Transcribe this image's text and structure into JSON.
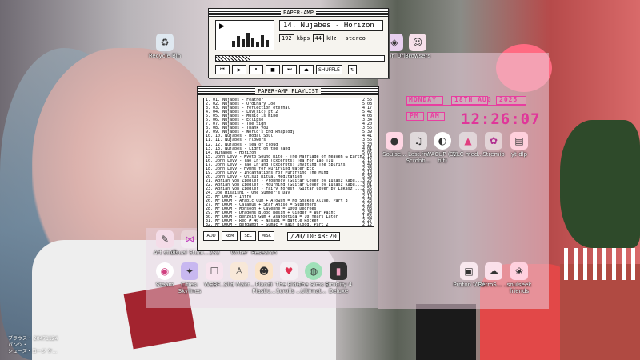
{
  "player": {
    "title": "PAPER-AMP",
    "track": "14. Nujabes - Horizon",
    "kbps_value": "192",
    "kbps_label": "kbps",
    "khz_value": "44",
    "khz_label": "kHz",
    "mode": "stereo",
    "shuffle": "SHUFFLE",
    "progress": 0.2
  },
  "playlist": {
    "title": "PAPER-AMP PLAYLIST",
    "time": "/20/10:48:20",
    "tracks": [
      {
        "t": "1. 01. Nujabes - Feather",
        "d": "2:55"
      },
      {
        "t": "2. 02. Nujabes - Ordinary Joe",
        "d": "5:08"
      },
      {
        "t": "3. 03. Nujabes - reflection eternal",
        "d": "4:17"
      },
      {
        "t": "4. 04. Nujabes - Luv(sic) pt.2",
        "d": "5:42"
      },
      {
        "t": "5. 05. Nujabes - Music is mine",
        "d": "4:08"
      },
      {
        "t": "6. 06. Nujabes - Eclipse",
        "d": "3:34"
      },
      {
        "t": "7. 07. Nujabes - The Sign",
        "d": "4:20"
      },
      {
        "t": "8. 08. Nujabes - Thank you",
        "d": "3:56"
      },
      {
        "t": "9. 09. Nujabes - World's End Rhapsody",
        "d": "5:39"
      },
      {
        "t": "10. 10. Nujabes - Modal Soul",
        "d": "4:41"
      },
      {
        "t": "11. 11. Nujabes - Flowers",
        "d": "3:55"
      },
      {
        "t": "12. 12. Nujabes - sea of cloud",
        "d": "3:20"
      },
      {
        "t": "13. 13. Nujabes - Light on the land",
        "d": "4:01"
      },
      {
        "t": "14. Nujabes - Horizon",
        "d": "5:05"
      },
      {
        "t": "15. John Levy - Kyoto Sound Rite - The Marriage of Heaven & Earth",
        "d": "2:14"
      },
      {
        "t": "16. John Levy - Tao Ch'ang (Excerpts) Tea For Lao Tzu",
        "d": "2:16"
      },
      {
        "t": "17. John Levy - Tao Ch'ang (Excerpts) Inviting The Spirits",
        "d": "3:49"
      },
      {
        "t": "18. John Levy - Hymns for Purifying Water Etc",
        "d": "2:33"
      },
      {
        "t": "19. John Levy - Incantations For Purifying The Mind",
        "d": "2:18"
      },
      {
        "t": "20. John Levy - Chisui Ritual Meditation",
        "d": "5:39"
      },
      {
        "t": "21. Adrian von Ziegler - Prophecy (Guitar Cover by Lukasz Kapu...",
        "d": "3:25"
      },
      {
        "t": "22. Adrian von Ziegler - Mourning (Guitar Cover by Lukasz Kapu...",
        "d": "3:01"
      },
      {
        "t": "23. Adrian von Ziegler - Fairy Forest (Guitar Cover by Lukasz ...",
        "d": "2:55"
      },
      {
        "t": "24. Joe Hisaishi - One Summer's Day",
        "d": "3:09"
      },
      {
        "t": "25. MF DOOM - Intro",
        "d": "2:10"
      },
      {
        "t": "26. MF DOOM - Arabic Gum + Ajowan = No Snakes Alive, Part 3",
        "d": "2:23"
      },
      {
        "t": "27. MF DOOM - Calamus + Star Anise = Superhero",
        "d": "2:29"
      },
      {
        "t": "28. MF DOOM - Monsoon + Cayenne = 1000 Degrees",
        "d": "2:08"
      },
      {
        "t": "29. MF DOOM - Dragons Blood Resin + Ginger = War Paint",
        "d": "2:34"
      },
      {
        "t": "30. MF DOOM - Benzoin Gum + Asafoetida = 10 Years Later",
        "d": "1:56"
      },
      {
        "t": "31. MF DOOM - Red # 40 + Wasabi = Battle Rocket",
        "d": "2:27"
      },
      {
        "t": "32. MF DOOM - Bergamot + Sumac = Rain Blood, Part 2",
        "d": "2:12"
      }
    ]
  },
  "clock": {
    "day": "MONDAY",
    "date": "18TH AUG",
    "year": "2025",
    "ampm_pm": "PM",
    "ampm_am": "AM",
    "time": "12:26:07"
  },
  "icons": {
    "recycle": "Recycle Bin",
    "proton_drive": "Proton Drive",
    "browsers": "Browsers",
    "soulseek": "Soulse...",
    "lastfm": "Last.fm Scrobb...",
    "wacup": "WACUP (32-bit)",
    "vlc": "VLC med...",
    "stremio": "Stremio",
    "ytdlp": "yt-dlp",
    "art": "Art stuff",
    "vs": "Visual Studi...",
    "e2": "2S2",
    "writer": "Writer",
    "research": "Research",
    "steam": "Steam",
    "cities": "Cities: Skylines",
    "webfish": "WEBF...",
    "slime": "Slid Makr...",
    "plandi": "Plandi Plastic...",
    "scrolls": "The Elder Scrolls ...",
    "sims": "The Sims 2 Ultimat...",
    "simcity": "SimCity 4 Deluxe",
    "protonvpn": "Proton VPN",
    "retro": "RetroS... ...",
    "soulfriends": "soulseek friends"
  },
  "corner": {
    "line1": "ブラウス・ 20471124",
    "line2": "パンツ・",
    "line3": "シューズ・コージ ケ..."
  }
}
